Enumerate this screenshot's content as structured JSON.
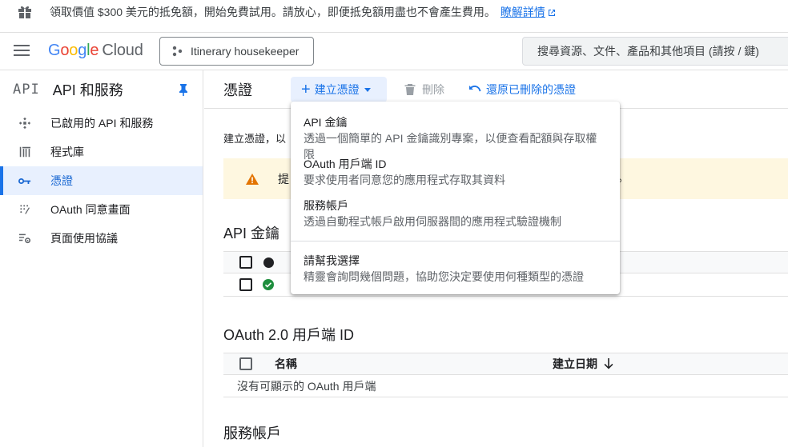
{
  "banner": {
    "text": "領取價值 $300 美元的抵免額，開始免費試用。請放心，即便抵免額用盡也不會產生費用。",
    "link": "瞭解詳情"
  },
  "topbar": {
    "logo_letters": [
      "G",
      "o",
      "o",
      "g",
      "l",
      "e"
    ],
    "logo_suffix": "Cloud",
    "project": "Itinerary housekeeper",
    "search_placeholder": "搜尋資源、文件、產品和其他項目 (請按 / 鍵)"
  },
  "sidebar": {
    "badge": "API",
    "title": "API 和服務",
    "items": [
      {
        "label": "已啟用的 API 和服務",
        "icon": "dashboard-icon",
        "active": false
      },
      {
        "label": "程式庫",
        "icon": "library-icon",
        "active": false
      },
      {
        "label": "憑證",
        "icon": "key-icon",
        "active": true
      },
      {
        "label": "OAuth 同意畫面",
        "icon": "oauth-icon",
        "active": false
      },
      {
        "label": "頁面使用協議",
        "icon": "settings-list-icon",
        "active": false
      }
    ]
  },
  "main": {
    "title": "憑證",
    "create_label": "建立憑證",
    "delete_label": "刪除",
    "restore_label": "還原已刪除的憑證",
    "description": "建立憑證，以",
    "warning_start": "提",
    "warning_end": "。",
    "api_keys": {
      "title": "API 金鑰"
    },
    "oauth": {
      "title": "OAuth 2.0 用戶端 ID",
      "col_name": "名稱",
      "col_date": "建立日期",
      "empty": "沒有可顯示的 OAuth 用戶端"
    },
    "service_accounts": {
      "title": "服務帳戶"
    }
  },
  "dropdown": {
    "items": [
      {
        "title": "API 金鑰",
        "subtitle": "透過一個簡單的 API 金鑰識別專案，以便查看配額與存取權限"
      },
      {
        "title": "OAuth 用戶端 ID",
        "subtitle": "要求使用者同意您的應用程式存取其資料"
      },
      {
        "title": "服務帳戶",
        "subtitle": "透過自動程式帳戶啟用伺服器間的應用程式驗證機制"
      }
    ],
    "help": {
      "title": "請幫我選擇",
      "subtitle": "精靈會詢問幾個問題，協助您決定要使用何種類型的憑證"
    }
  },
  "colors": {
    "accent": "#1a73e8",
    "active_bg": "#e8f0fe",
    "warning_bg": "#fef7e0",
    "warning_icon": "#e37400",
    "success": "#1e8e3e"
  }
}
